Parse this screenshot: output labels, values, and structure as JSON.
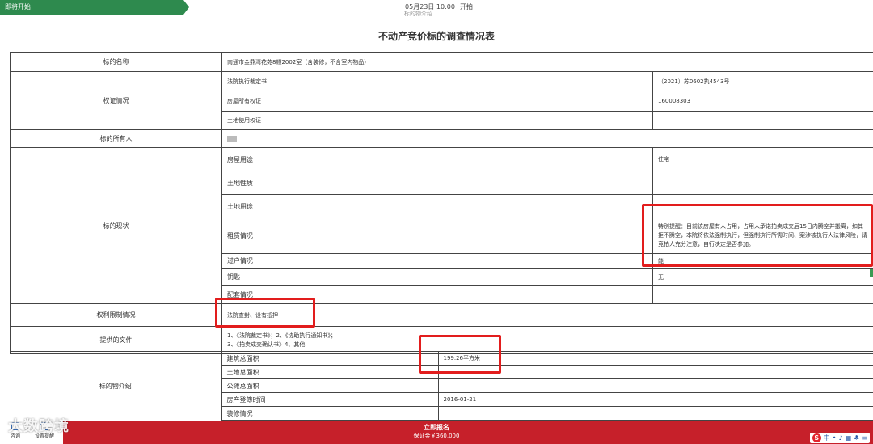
{
  "top_bar": {
    "status": "即将开始",
    "date_time": "05月23日 10:00",
    "state": "开拍",
    "faint_label": "标的物介绍"
  },
  "page_title": "不动产竞价标的调查情况表",
  "table": {
    "subject_name_label": "标的名称",
    "subject_name_value": "南通市金鼎湾花苑8幢2002室（含装修，不含室内物品）",
    "title_status_label": "权证情况",
    "court_ruling_label": "法院执行裁定书",
    "court_ruling_value": "（2021）苏0602执4543号",
    "property_cert_label": "房屋所有权证",
    "property_cert_value": "160008303",
    "land_cert_label": "土地使用权证",
    "land_cert_value": "",
    "owner_label": "标的所有人",
    "status_label": "标的现状",
    "house_use_label": "房屋用途",
    "house_use_value": "住宅",
    "land_nature_label": "土地性质",
    "land_nature_value": "",
    "land_use_label": "土地用途",
    "land_use_value": "",
    "lease_label": "租赁情况",
    "lease_value": "特别提醒：目前该房屋有人占用，占用人承诺拍卖成交后15日内腾空并搬离，如其拒不腾空，本院将依法强制执行，但强制执行所需时间、案涉被执行人法律风险，请竞拍人充分注意，自行决定是否参加。",
    "transfer_label": "过户情况",
    "transfer_value": "能",
    "keys_label": "钥匙",
    "keys_value": "无",
    "facilities_label": "配套情况",
    "facilities_value": "",
    "restriction_label": "权利限制情况",
    "restriction_value": "法院查封、设有抵押",
    "documents_label": "提供的文件",
    "documents_line1": "1、《法院裁定书》；2、《协助执行通知书》；",
    "documents_line2": "3、《拍卖成交确认书》4、其他",
    "intro_label": "标的物介绍",
    "building_area_label": "建筑总面积",
    "building_area_value": "199.26平方米",
    "land_area_label": "土地总面积",
    "land_area_value": "",
    "shared_area_label": "公摊总面积",
    "shared_area_value": "",
    "register_date_label": "房产登簿时间",
    "register_date_value": "2016-01-21",
    "decoration_label": "装修情况",
    "decoration_value": ""
  },
  "bottom_bar": {
    "tool_consult": "咨询",
    "tool_reminder": "设置提醒",
    "signup_label": "立即报名",
    "deposit": "保证金￥360,000"
  },
  "watermark": "大数跨境",
  "ime": {
    "logo": "S",
    "lang": "中"
  },
  "colors": {
    "green": "#2e8a4e",
    "red": "#c6202a",
    "highlight": "#e21d1d"
  }
}
